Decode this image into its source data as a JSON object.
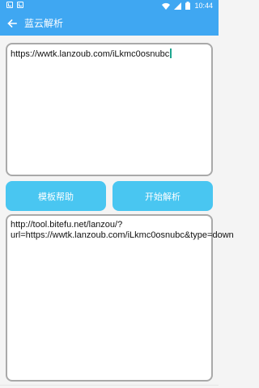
{
  "status_bar": {
    "time": "10:44",
    "icons": [
      "notification-icon",
      "notification-icon",
      "wifi-icon",
      "signal-icon",
      "battery-icon"
    ]
  },
  "app_bar": {
    "back_icon": "arrow-left-icon",
    "title": "蓝云解析"
  },
  "input": {
    "value": "https://wwtk.lanzoub.com/iLkmc0osnubc"
  },
  "buttons": {
    "help": "模板帮助",
    "parse": "开始解析"
  },
  "output": {
    "value": "http://tool.bitefu.net/lanzou/?url=https://wwtk.lanzoub.com/iLkmc0osnubc&type=down"
  },
  "colors": {
    "primary": "#3fa7f2",
    "button": "#49c6f1",
    "border": "#a9a9a9",
    "background": "#f4f4f4"
  }
}
